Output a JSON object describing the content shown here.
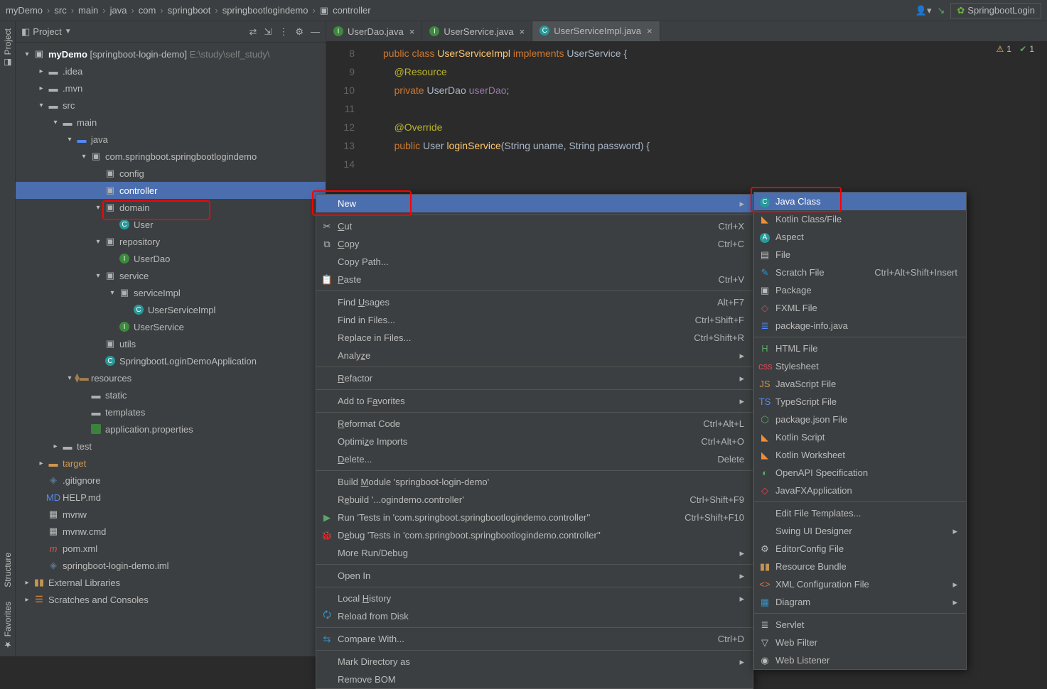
{
  "breadcrumb": [
    "myDemo",
    "src",
    "main",
    "java",
    "com",
    "springboot",
    "springbootlogindemo",
    "controller"
  ],
  "runconfig": "SpringbootLogin",
  "left_tools": {
    "project": "Project",
    "structure": "Structure",
    "favorites": "Favorites"
  },
  "project_header": {
    "title": "Project"
  },
  "tree": {
    "root": "myDemo",
    "root_module": "[springboot-login-demo]",
    "root_path": "E:\\study\\self_study\\",
    "idea": ".idea",
    "mvn": ".mvn",
    "src": "src",
    "main": "main",
    "java": "java",
    "pkg": "com.springboot.springbootlogindemo",
    "config": "config",
    "controller": "controller",
    "domain": "domain",
    "user": "User",
    "repository": "repository",
    "userdao": "UserDao",
    "service": "service",
    "serviceimpl": "serviceImpl",
    "userserviceimpl": "UserServiceImpl",
    "userservice": "UserService",
    "utils": "utils",
    "app": "SpringbootLoginDemoApplication",
    "resources": "resources",
    "static": "static",
    "templates": "templates",
    "appprops": "application.properties",
    "test": "test",
    "target": "target",
    "gitignore": ".gitignore",
    "helpmd": "HELP.md",
    "mvnw": "mvnw",
    "mvnwcmd": "mvnw.cmd",
    "pomxml": "pom.xml",
    "iml": "springboot-login-demo.iml",
    "extlib": "External Libraries",
    "scratches": "Scratches and Consoles"
  },
  "tabs": [
    {
      "name": "UserDao.java",
      "active": false,
      "icon": "I"
    },
    {
      "name": "UserService.java",
      "active": false,
      "icon": "I"
    },
    {
      "name": "UserServiceImpl.java",
      "active": true,
      "icon": "C"
    }
  ],
  "code": {
    "line_start": 8,
    "l9": "public class UserServiceImpl implements UserService {",
    "l10": "    @Resource",
    "l11": "    private UserDao userDao;",
    "l12": "",
    "l13": "    @Override",
    "l14": "    public User loginService(String uname, String password) {"
  },
  "inspections": {
    "warn": "1",
    "ok": "1"
  },
  "ctx_menu": {
    "new": "New",
    "cut": "Cut",
    "cut_s": "Ctrl+X",
    "copy": "Copy",
    "copy_s": "Ctrl+C",
    "copypath": "Copy Path...",
    "paste": "Paste",
    "paste_s": "Ctrl+V",
    "findusages": "Find Usages",
    "findusages_s": "Alt+F7",
    "findinfiles": "Find in Files...",
    "findinfiles_s": "Ctrl+Shift+F",
    "replaceinfiles": "Replace in Files...",
    "replaceinfiles_s": "Ctrl+Shift+R",
    "analyze": "Analyze",
    "refactor": "Refactor",
    "addtofav": "Add to Favorites",
    "reformat": "Reformat Code",
    "reformat_s": "Ctrl+Alt+L",
    "optimize": "Optimize Imports",
    "optimize_s": "Ctrl+Alt+O",
    "delete": "Delete...",
    "delete_s": "Delete",
    "buildmod": "Build Module 'springboot-login-demo'",
    "rebuild": "Rebuild '...ogindemo.controller'",
    "rebuild_s": "Ctrl+Shift+F9",
    "runtests": "Run 'Tests in 'com.springboot.springbootlogindemo.controller''",
    "runtests_s": "Ctrl+Shift+F10",
    "debugtests": "Debug 'Tests in 'com.springboot.springbootlogindemo.controller''",
    "morerun": "More Run/Debug",
    "openin": "Open In",
    "localhist": "Local History",
    "reload": "Reload from Disk",
    "compare": "Compare With...",
    "compare_s": "Ctrl+D",
    "markdir": "Mark Directory as",
    "removebom": "Remove BOM"
  },
  "new_menu": {
    "javaclass": "Java Class",
    "kotlinclass": "Kotlin Class/File",
    "aspect": "Aspect",
    "file": "File",
    "scratch": "Scratch File",
    "scratch_s": "Ctrl+Alt+Shift+Insert",
    "package": "Package",
    "fxml": "FXML File",
    "pkginfo": "package-info.java",
    "html": "HTML File",
    "stylesheet": "Stylesheet",
    "jsfile": "JavaScript File",
    "tsfile": "TypeScript File",
    "pkgjson": "package.json File",
    "kotlinscript": "Kotlin Script",
    "kotlinws": "Kotlin Worksheet",
    "openapi": "OpenAPI Specification",
    "javafx": "JavaFXApplication",
    "editfiletmpl": "Edit File Templates...",
    "swing": "Swing UI Designer",
    "editorconfig": "EditorConfig File",
    "resbundle": "Resource Bundle",
    "xmlconf": "XML Configuration File",
    "diagram": "Diagram",
    "servlet": "Servlet",
    "webfilter": "Web Filter",
    "weblistener": "Web Listener"
  }
}
